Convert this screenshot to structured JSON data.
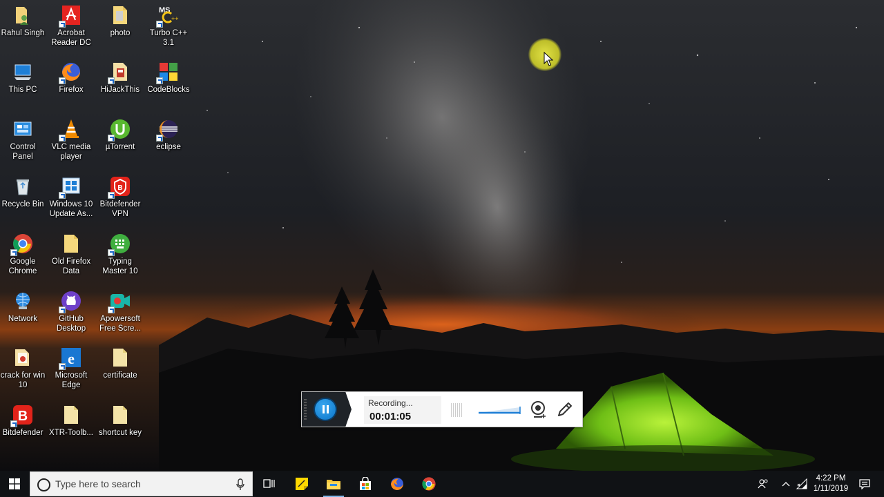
{
  "desktop": {
    "icons": [
      {
        "label": "Rahul Singh",
        "icon": "user-folder-icon"
      },
      {
        "label": "Acrobat\nReader DC",
        "icon": "acrobat-icon"
      },
      {
        "label": "photo",
        "icon": "folder-icon"
      },
      {
        "label": "Turbo C++\n3.1",
        "icon": "turbo-cpp-icon"
      },
      {
        "label": "This PC",
        "icon": "computer-icon"
      },
      {
        "label": "Firefox",
        "icon": "firefox-icon"
      },
      {
        "label": "HiJackThis",
        "icon": "hijackthis-icon"
      },
      {
        "label": "CodeBlocks",
        "icon": "codeblocks-icon"
      },
      {
        "label": "Control\nPanel",
        "icon": "control-panel-icon"
      },
      {
        "label": "VLC media\nplayer",
        "icon": "vlc-icon"
      },
      {
        "label": "µTorrent",
        "icon": "utorrent-icon"
      },
      {
        "label": "eclipse",
        "icon": "eclipse-icon"
      },
      {
        "label": "Recycle Bin",
        "icon": "recycle-bin-icon"
      },
      {
        "label": "Windows 10\nUpdate As...",
        "icon": "windows-update-icon"
      },
      {
        "label": "Bitdefender\nVPN",
        "icon": "bitdefender-vpn-icon"
      },
      {
        "label": "Google\nChrome",
        "icon": "chrome-icon"
      },
      {
        "label": "Old Firefox\nData",
        "icon": "folder-icon"
      },
      {
        "label": "Typing\nMaster 10",
        "icon": "typing-master-icon"
      },
      {
        "label": "Network",
        "icon": "network-icon"
      },
      {
        "label": "GitHub\nDesktop",
        "icon": "github-icon"
      },
      {
        "label": "Apowersoft\nFree Scre...",
        "icon": "apowersoft-icon"
      },
      {
        "label": "crack for win\n10",
        "icon": "folder-icon"
      },
      {
        "label": "Microsoft\nEdge",
        "icon": "edge-icon"
      },
      {
        "label": "certificate",
        "icon": "folder-icon"
      },
      {
        "label": "Bitdefender",
        "icon": "bitdefender-icon"
      },
      {
        "label": "XTR-Toolb...",
        "icon": "folder-icon"
      },
      {
        "label": "shortcut key",
        "icon": "folder-icon"
      }
    ]
  },
  "recorder": {
    "status": "Recording...",
    "elapsed": "00:01:05"
  },
  "taskbar": {
    "search_placeholder": "Type here to search",
    "time": "4:22 PM",
    "date": "1/11/2019"
  },
  "colors": {
    "taskbar_bg": "#101215",
    "accent_blue": "#0a74c8",
    "highlight_yellow": "#e6e646"
  }
}
